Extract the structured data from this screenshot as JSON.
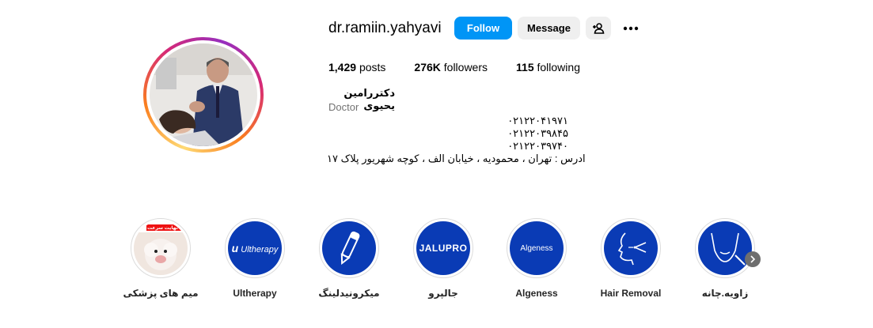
{
  "profile": {
    "username": "dr.ramiin.yahyavi",
    "full_name": "دکتررامین یحیوی",
    "category": "Doctor",
    "bio_lines": [
      "۰۲۱۲۲۰۴۱۹۷۱",
      "۰۲۱۲۲۰۳۹۸۴۵",
      "۰۲۱۲۲۰۳۹۷۴۰",
      "ادرس : تهران ، محمودیه ، خیابان الف ، کوچه شهریور پلاک ۱۷"
    ]
  },
  "actions": {
    "follow_label": "Follow",
    "message_label": "Message",
    "add_user_icon": "person-add-icon",
    "more_icon": "more-horizontal-icon"
  },
  "stats": {
    "posts_count": "1,429",
    "posts_label": "posts",
    "followers_count": "276K",
    "followers_label": "followers",
    "following_count": "115",
    "following_label": "following"
  },
  "highlights": [
    {
      "label": "میم های پزشکی",
      "badge": "ونه نهایت سرعت",
      "icon": "meme-photo"
    },
    {
      "label": "Ultherapy",
      "logo": "Ultherapy",
      "icon": "ultherapy-logo"
    },
    {
      "label": "میکرونیدلینگ",
      "icon": "microneedling-pen-icon"
    },
    {
      "label": "جالپرو",
      "logo": "JALUPRO",
      "icon": "jalupro-logo"
    },
    {
      "label": "Algeness",
      "logo": "Algeness",
      "icon": "algeness-logo"
    },
    {
      "label": "Hair Removal",
      "icon": "laser-face-icon"
    },
    {
      "label": "زاویه.چانه",
      "icon": "jaw-injection-icon"
    }
  ],
  "colors": {
    "follow_button": "#0095f6",
    "secondary_button": "#efefef",
    "highlight_bg": "#0a3bb5",
    "muted_text": "#737373"
  }
}
